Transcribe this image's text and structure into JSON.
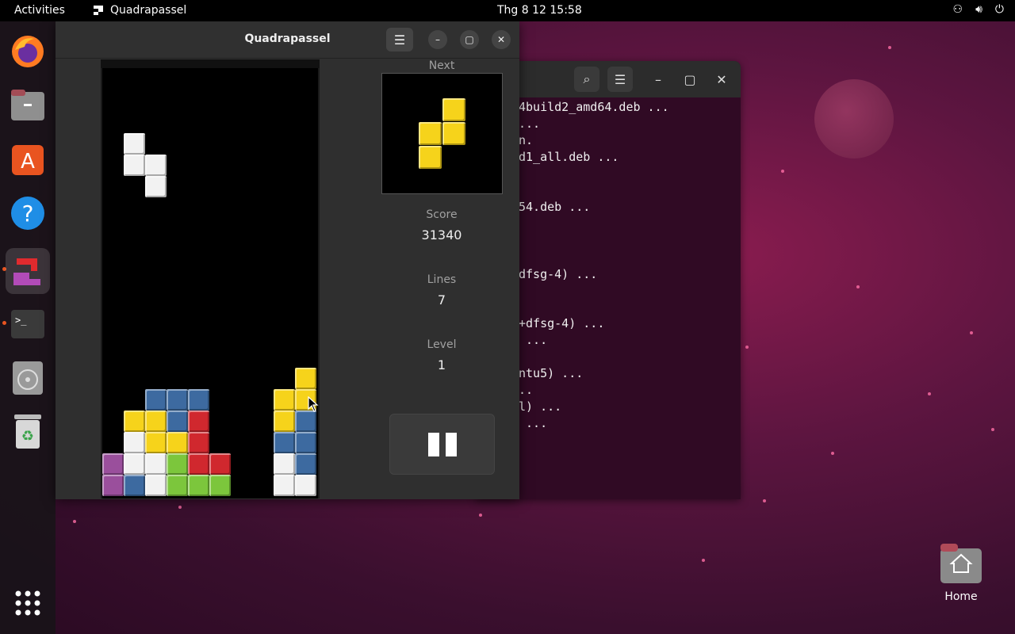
{
  "topbar": {
    "activities": "Activities",
    "app_name": "Quadrapassel",
    "clock": "Thg 8 12  15:58"
  },
  "dock": {
    "items": [
      "firefox-icon",
      "files-icon",
      "app-center-icon",
      "help-icon",
      "quadrapassel-icon",
      "terminal-icon",
      "disc-icon",
      "trash-icon",
      "show-apps-icon"
    ]
  },
  "game": {
    "title": "Quadrapassel",
    "next_label": "Next",
    "score_label": "Score",
    "score_value": "31340",
    "lines_label": "Lines",
    "lines_value": "7",
    "level_label": "Level",
    "level_value": "1"
  },
  "terminal": {
    "lines": [
      "4build2_amd64.deb ...",
      "...",
      "n.",
      "d1_all.deb ...",
      "54.deb ...",
      "dfsg-4) ...",
      "+dfsg-4) ...",
      " ...",
      "ntu5) ...",
      "..",
      "l) ...",
      " ..."
    ]
  },
  "desktop": {
    "home_label": "Home"
  },
  "colors": {
    "yellow": "#f6d31b",
    "white": "#f2f2f2",
    "blue": "#3d6aa0",
    "red": "#d0282e",
    "green": "#7cc63c",
    "purple": "#9a4f9c"
  }
}
